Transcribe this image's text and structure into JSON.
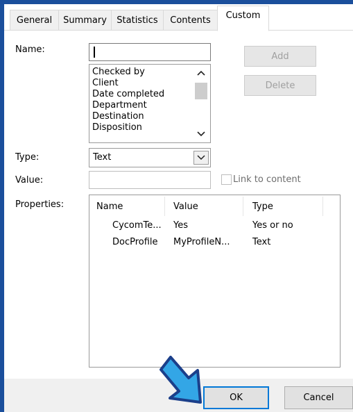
{
  "tabs": [
    {
      "label": "General",
      "active": false
    },
    {
      "label": "Summary",
      "active": false
    },
    {
      "label": "Statistics",
      "active": false
    },
    {
      "label": "Contents",
      "active": false
    },
    {
      "label": "Custom",
      "active": true
    }
  ],
  "name_field": {
    "label": "Name:",
    "value": ""
  },
  "name_list": [
    "Checked by",
    "Client",
    "Date completed",
    "Department",
    "Destination",
    "Disposition"
  ],
  "buttons": {
    "add": "Add",
    "delete": "Delete",
    "ok": "OK",
    "cancel": "Cancel"
  },
  "type_field": {
    "label": "Type:",
    "value": "Text"
  },
  "value_field": {
    "label": "Value:",
    "value": ""
  },
  "link_to_content": {
    "label": "Link to content",
    "checked": false
  },
  "properties": {
    "label": "Properties:",
    "headers": [
      "Name",
      "Value",
      "Type"
    ],
    "rows": [
      [
        "CycomTe...",
        "Yes",
        "Yes or no"
      ],
      [
        "DocProfile",
        "MyProfileN...",
        "Text"
      ]
    ]
  },
  "colors": {
    "frame": "#1b4f9c",
    "arrow_fill": "#33a6e6",
    "arrow_stroke": "#1b3f8a",
    "ok_border": "#0078d7"
  },
  "icons": {
    "annotation": "arrow-pointing-at-ok"
  }
}
